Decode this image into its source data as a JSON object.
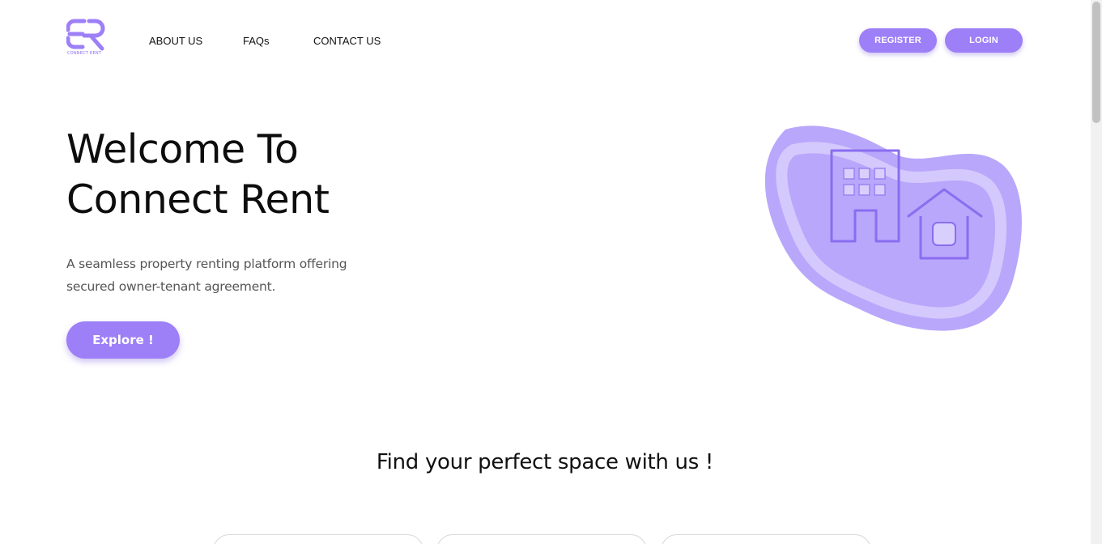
{
  "brand": {
    "logo_text": "CONNECT RENT",
    "accent_color": "#9d7ff7"
  },
  "nav": {
    "links": [
      "ABOUT US",
      "FAQs",
      "CONTACT US"
    ],
    "register_label": "REGISTER",
    "login_label": "LOGIN"
  },
  "hero": {
    "title_line1": "Welcome To",
    "title_line2": "Connect Rent",
    "description": "A seamless property renting platform offering secured owner-tenant agreement.",
    "cta_label": "Explore !",
    "illustration_icons": [
      "building-icon",
      "house-icon"
    ]
  },
  "section": {
    "title": "Find your perfect space with us !"
  }
}
